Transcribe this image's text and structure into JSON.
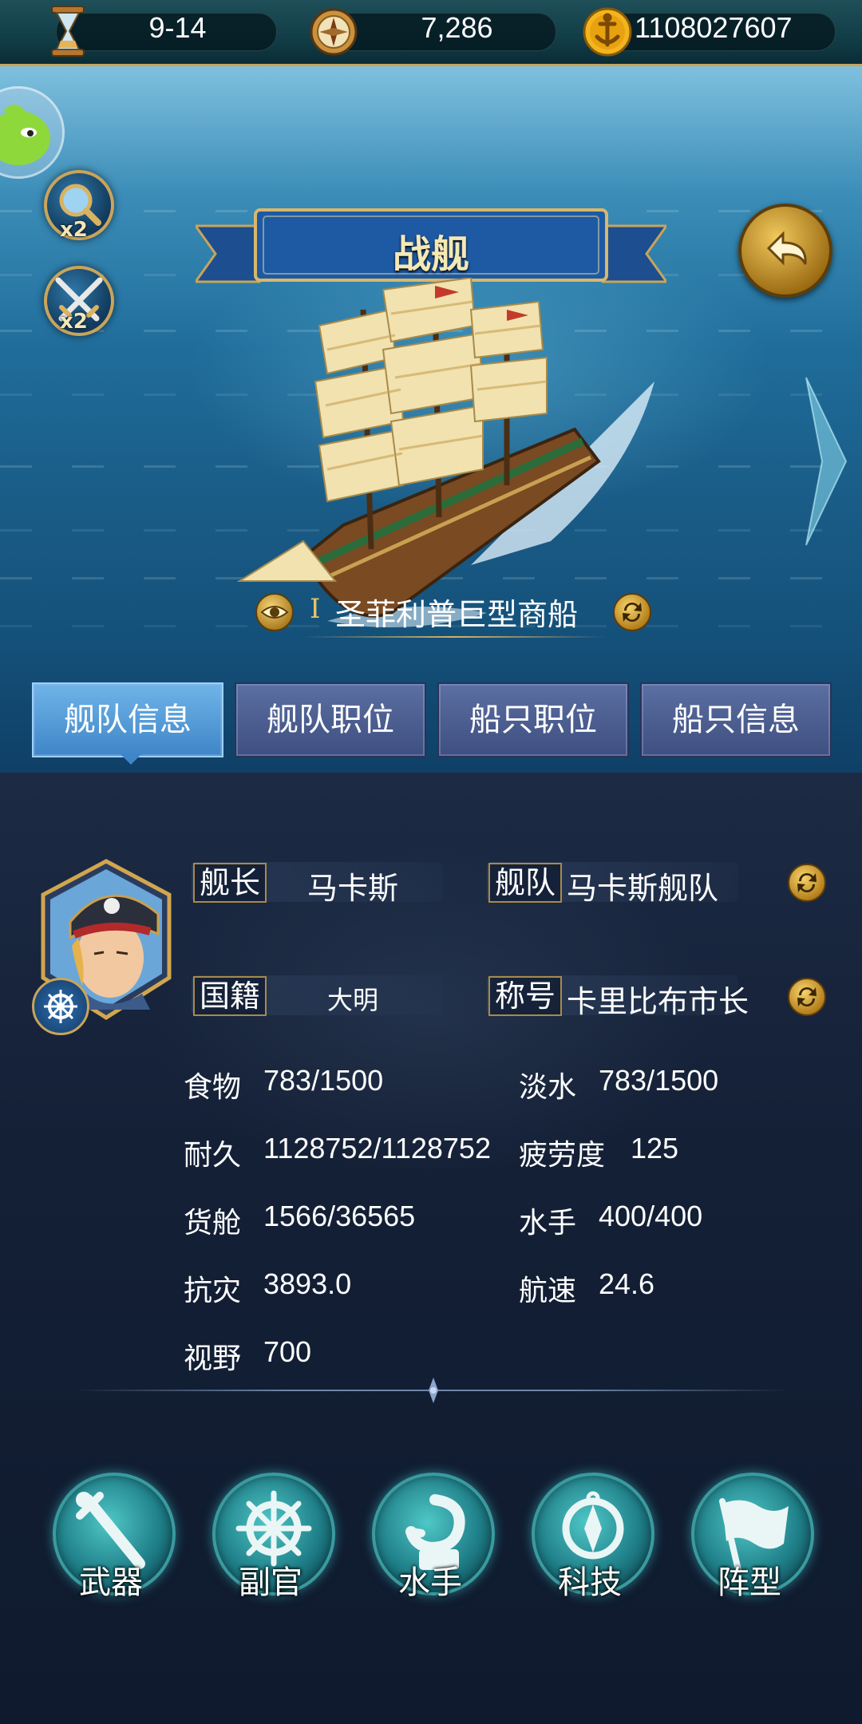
{
  "topbar": {
    "date": "9-14",
    "compass_value": "7,286",
    "gold": "1108027607"
  },
  "scene": {
    "banner_title": "战舰",
    "ship_name": "圣菲利普巨型商船",
    "ship_rank": "I",
    "speed_boost_label": "x2",
    "battle_boost_label": "x2"
  },
  "tabs": [
    {
      "label": "舰队信息",
      "active": true
    },
    {
      "label": "舰队职位",
      "active": false
    },
    {
      "label": "船只职位",
      "active": false
    },
    {
      "label": "船只信息",
      "active": false
    }
  ],
  "info": {
    "captain_label": "舰长",
    "captain_value": "马卡斯",
    "fleet_label": "舰队",
    "fleet_value": "马卡斯舰队",
    "nationality_label": "国籍",
    "nationality_value": "大明",
    "title_label": "称号",
    "title_value": "卡里比布市长"
  },
  "stats": [
    {
      "label": "食物",
      "value": "783/1500"
    },
    {
      "label": "淡水",
      "value": "783/1500"
    },
    {
      "label": "耐久",
      "value": "1128752/1128752"
    },
    {
      "label": "疲劳度",
      "value": "125"
    },
    {
      "label": "货舱",
      "value": "1566/36565"
    },
    {
      "label": "水手",
      "value": "400/400"
    },
    {
      "label": "抗灾",
      "value": "3893.0"
    },
    {
      "label": "航速",
      "value": "24.6"
    },
    {
      "label": "视野",
      "value": "700"
    }
  ],
  "actions": [
    {
      "label": "武器",
      "icon": "sword-icon"
    },
    {
      "label": "副官",
      "icon": "ship-wheel-icon"
    },
    {
      "label": "水手",
      "icon": "hook-icon"
    },
    {
      "label": "科技",
      "icon": "compass-icon"
    },
    {
      "label": "阵型",
      "icon": "flag-icon"
    }
  ]
}
